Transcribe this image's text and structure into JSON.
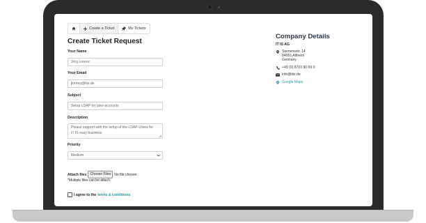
{
  "tabs": [
    {
      "label": "Create a Ticket"
    },
    {
      "label": "My Tickets"
    }
  ],
  "form": {
    "title": "Create Ticket Request",
    "name_label": "Your Name",
    "name_value": "Jörg Lorenz",
    "email_label": "Your Email",
    "email_value": "jlorenz@itis.de",
    "subject_label": "Subject",
    "subject_value": "Setup LDAP for user-accounts",
    "description_label": "Description",
    "description_line1": "Please support with the setup of the LDAP-Users for",
    "description_line2": "IT IS easy business",
    "priority_label": "Priority",
    "priority_value": "Medium",
    "attach_label": "Attach files",
    "choose_files": "Choose Files",
    "no_file": "No file chosen",
    "attach_note": "*Multiple files can be attach.",
    "agree_prefix": "I agree to the",
    "agree_link": "terms & conditions"
  },
  "company": {
    "title": "Company Details",
    "name": "IT IS AG",
    "address_line1": "Siemensstr. 14",
    "address_line2": "84051 Altheim",
    "address_line3": "Germany",
    "phone": "+49 (0) 8703 90 69 0",
    "email": "info@itis.de",
    "maps_link": "Google Maps"
  },
  "colors": {
    "accent": "#1f9aa6",
    "laptop_body": "#2b2b2b",
    "laptop_base": "#c9c9c9"
  },
  "icons": [
    "home-icon",
    "plus-icon",
    "pin-icon",
    "map-marker-icon",
    "phone-icon",
    "envelope-icon",
    "chevron-down-icon"
  ]
}
